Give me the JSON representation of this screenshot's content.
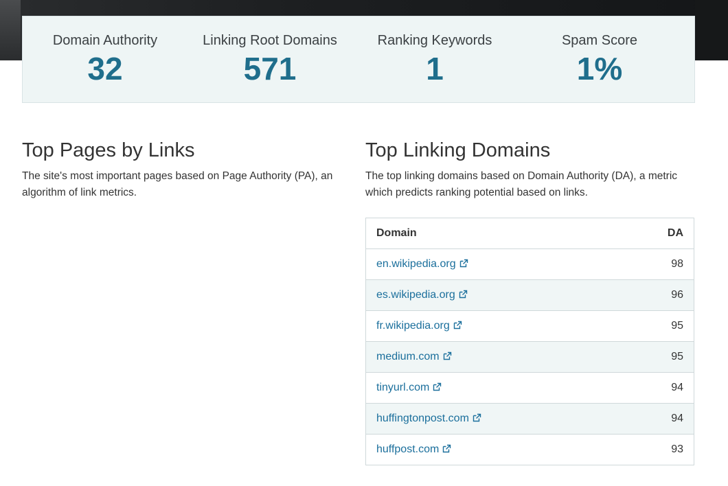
{
  "stats": [
    {
      "label": "Domain Authority",
      "value": "32"
    },
    {
      "label": "Linking Root Domains",
      "value": "571"
    },
    {
      "label": "Ranking Keywords",
      "value": "1"
    },
    {
      "label": "Spam Score",
      "value": "1%"
    }
  ],
  "top_pages": {
    "title": "Top Pages by Links",
    "description": "The site's most important pages based on Page Authority (PA), an algorithm of link metrics."
  },
  "top_linking_domains": {
    "title": "Top Linking Domains",
    "description": "The top linking domains based on Domain Authority (DA), a metric which predicts ranking potential based on links.",
    "columns": {
      "domain": "Domain",
      "da": "DA"
    },
    "rows": [
      {
        "domain": "en.wikipedia.org",
        "da": "98"
      },
      {
        "domain": "es.wikipedia.org",
        "da": "96"
      },
      {
        "domain": "fr.wikipedia.org",
        "da": "95"
      },
      {
        "domain": "medium.com",
        "da": "95"
      },
      {
        "domain": "tinyurl.com",
        "da": "94"
      },
      {
        "domain": "huffingtonpost.com",
        "da": "94"
      },
      {
        "domain": "huffpost.com",
        "da": "93"
      }
    ]
  },
  "icons": {
    "external_link": "external-link-icon"
  },
  "colors": {
    "accent": "#1f6e8c",
    "link": "#1b6f9c",
    "stats_bg": "#eef5f5",
    "row_alt": "#f0f6f6"
  }
}
